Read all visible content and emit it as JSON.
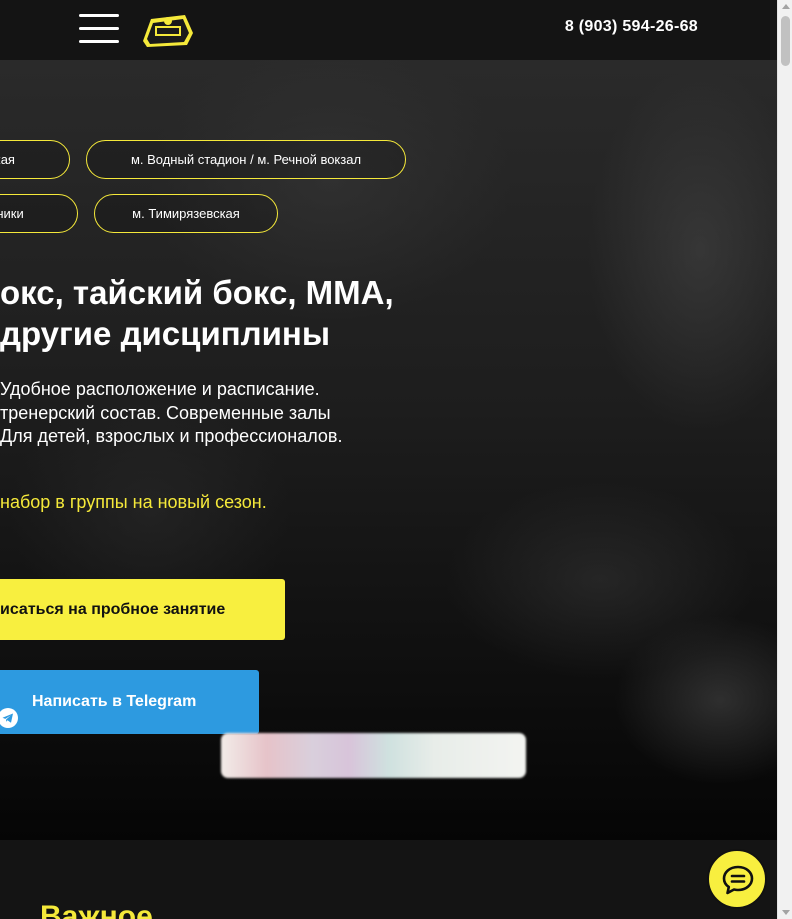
{
  "header": {
    "phone": "8 (903) 594-26-68",
    "menu_icon": "hamburger-menu-icon",
    "logo_icon": "club-logo-icon"
  },
  "hero": {
    "metro_chips": [
      "рская",
      "м. Водный стадион / м. Речной вокзал",
      "ужники",
      "м. Тимирязевская"
    ],
    "title_line1": "окс, тайский бокс, ММА,",
    "title_line2": "другие дисциплины",
    "desc_line1": " Удобное расположение и расписание.",
    "desc_line2": "тренерский состав. Современные залы",
    "desc_line3": "Для детей, взрослых и профессионалов.",
    "season_text": "набор в группы на новый сезон.",
    "trial_button": "исаться на пробное занятие",
    "telegram_button": "Написать в Telegram",
    "telegram_icon": "telegram-plane-icon"
  },
  "important": {
    "title": "Важное"
  },
  "chat": {
    "icon": "chat-bubble-icon"
  },
  "colors": {
    "accent_yellow": "#f8ef3f",
    "telegram_blue": "#2d9ae0",
    "background_dark": "#141414"
  }
}
